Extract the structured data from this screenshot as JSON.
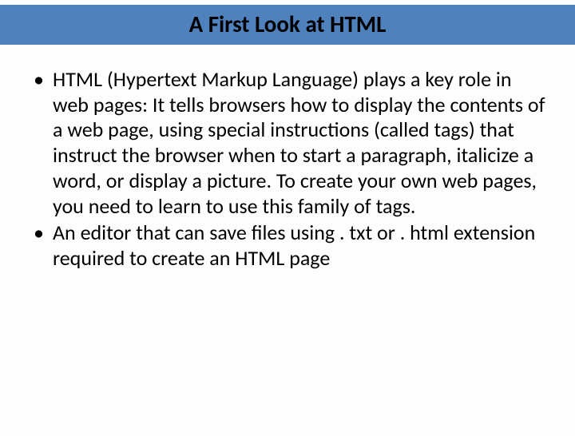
{
  "slide": {
    "title": "A First Look at HTML",
    "bullets": [
      "HTML (Hypertext Markup Language) plays a key role in web pages: It tells browsers how to display the contents of a web page, using special instructions (called tags) that instruct the browser when to start a paragraph, italicize a word, or display a picture. To create your own web pages, you need to learn to use this family of tags.",
      "An editor that can save files using . txt or . html extension required to create an HTML page"
    ]
  }
}
